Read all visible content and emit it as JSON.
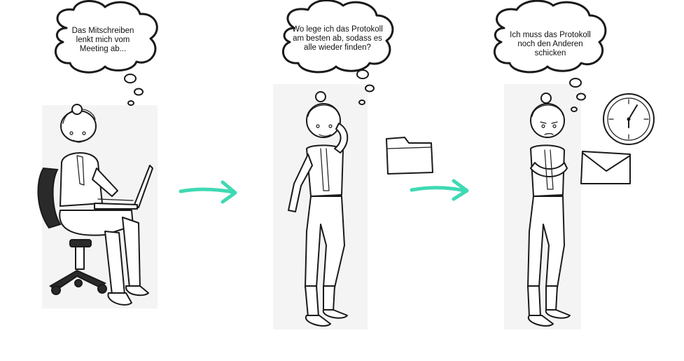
{
  "panels": [
    {
      "thought_lines": [
        "Das Mitschreiben",
        "lenkt mich vom",
        "Meeting ab..."
      ],
      "figure": "woman-typing-on-laptop-in-office-chair"
    },
    {
      "thought_lines": [
        "Wo lege ich das Protokoll",
        "am besten ab, sodass es",
        "alle wieder finden?"
      ],
      "figure": "woman-standing-thinking",
      "prop_icon": "folder-icon"
    },
    {
      "thought_lines": [
        "Ich muss das Protokoll",
        "noch den Anderen",
        "schicken"
      ],
      "figure": "woman-standing-arms-crossed",
      "prop_icons": [
        "clock-icon",
        "envelope-icon"
      ]
    }
  ],
  "colors": {
    "arrow": "#3fd9b4",
    "ink": "#1a1a1a",
    "paper": "#ffffff"
  }
}
